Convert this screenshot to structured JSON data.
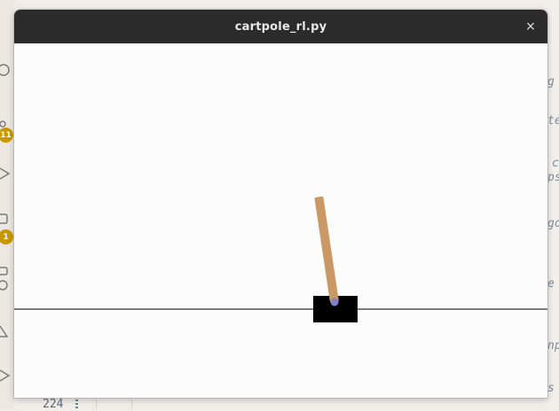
{
  "window": {
    "title": "cartpole_rl.py",
    "close_glyph": "×",
    "titlebar_color": "#2b2b2b",
    "canvas_color": "#fdfcfc"
  },
  "activity_bar": {
    "badges": [
      "11",
      "1"
    ],
    "badge_color": "#c79800"
  },
  "editor": {
    "line_number": "224"
  },
  "cartpole": {
    "cart_color": "#000000",
    "pole_color": "#ca9865",
    "axle_color": "#8181cb",
    "track_color": "#000000"
  }
}
